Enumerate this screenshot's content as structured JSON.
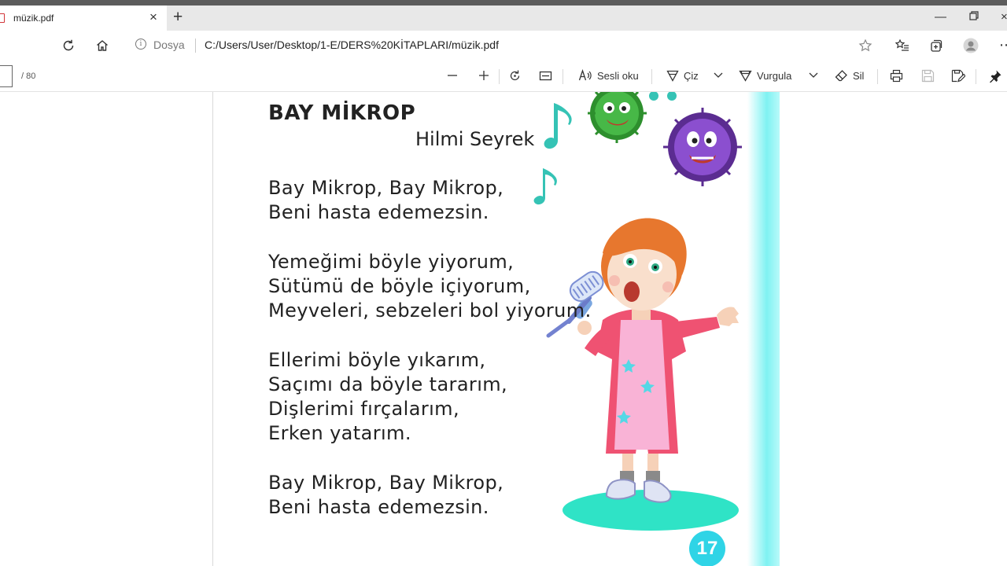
{
  "browser": {
    "tab": {
      "title": "müzik.pdf"
    },
    "address": {
      "site_label": "Dosya",
      "url": "C:/Users/User/Desktop/1-E/DERS%20KİTAPLARI/müzik.pdf"
    }
  },
  "pdf_toolbar": {
    "page_current": "",
    "page_total": "/ 80",
    "read_aloud_label": "Sesli oku",
    "draw_label": "Çiz",
    "highlight_label": "Vurgula",
    "erase_label": "Sil"
  },
  "page": {
    "title": "BAY MİKROP",
    "author": "Hilmi Seyrek",
    "stanzas": [
      [
        "Bay Mikrop, Bay Mikrop,",
        "Beni hasta edemezsin."
      ],
      [
        "Yemeğimi böyle yiyorum,",
        "Sütümü de böyle içiyorum,",
        "Meyveleri, sebzeleri bol yiyorum."
      ],
      [
        "Ellerimi böyle yıkarım,",
        "Saçımı da böyle tararım,",
        "Dişlerimi fırçalarım,",
        "Erken yatarım."
      ],
      [
        "Bay Mikrop, Bay Mikrop,",
        "Beni hasta edemezsin."
      ]
    ],
    "page_number": "17"
  },
  "colors": {
    "accent_cyan": "#2fd4e6",
    "note_teal": "#35c3b5",
    "germ_green": "#3aa53a",
    "germ_purple": "#7b3fb8"
  }
}
